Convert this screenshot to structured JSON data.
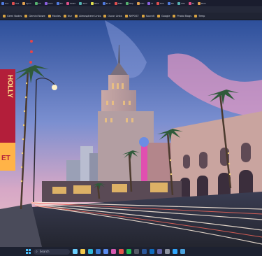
{
  "window": {
    "tabs": [
      {
        "label": "Fon",
        "color": "#4f7be0"
      },
      {
        "label": "Pat",
        "color": "#e04f4f"
      },
      {
        "label": "Spon",
        "color": "#e0a14f"
      },
      {
        "label": "Xa",
        "color": "#55b36f"
      },
      {
        "label": "Gem",
        "color": "#8a5fe0"
      },
      {
        "label": "Pix",
        "color": "#4f7be0"
      },
      {
        "label": "Saam",
        "color": "#e04f8a"
      },
      {
        "label": "Sam",
        "color": "#55b3b3"
      },
      {
        "label": "Nike",
        "color": "#e0e04f"
      },
      {
        "label": "Bl ar",
        "color": "#4f7be0"
      },
      {
        "label": "Nike",
        "color": "#e04f4f"
      },
      {
        "label": "Rep",
        "color": "#55b36f"
      },
      {
        "label": "Pbo",
        "color": "#e0a14f"
      },
      {
        "label": "Pi",
        "color": "#8a5fe0"
      },
      {
        "label": "Pick",
        "color": "#e04f4f"
      },
      {
        "label": "Re",
        "color": "#4f7be0"
      },
      {
        "label": "Inte",
        "color": "#55b3b3"
      },
      {
        "label": "Fa",
        "color": "#e04f8a"
      },
      {
        "label": "Rem",
        "color": "#e0a14f"
      }
    ]
  },
  "bookmarks": {
    "items": [
      {
        "label": "Gemi Nodes"
      },
      {
        "label": "Gemini Nowe"
      },
      {
        "label": "Movies"
      },
      {
        "label": "Nur"
      },
      {
        "label": "Atmosphere Links"
      },
      {
        "label": "Oscar Links"
      },
      {
        "label": "NYPOST"
      },
      {
        "label": "Soundt"
      },
      {
        "label": "Google"
      },
      {
        "label": "Photo Blogs"
      },
      {
        "label": "Temp"
      }
    ]
  },
  "content": {
    "signs": {
      "theater_top": "HOLLY",
      "theater_bottom": "ET"
    }
  },
  "taskbar": {
    "search_placeholder": "Search",
    "apps": [
      {
        "icon": "copilot-icon",
        "color": "#6bd0ff"
      },
      {
        "icon": "file-explorer-icon",
        "color": "#f2c94c"
      },
      {
        "icon": "edge-icon",
        "color": "#2fb8d8"
      },
      {
        "icon": "mail-icon",
        "color": "#3a7bd5"
      },
      {
        "icon": "store-icon",
        "color": "#5b8def"
      },
      {
        "icon": "photos-icon",
        "color": "#d65ab0"
      },
      {
        "icon": "chrome-icon",
        "color": "#e5534b"
      },
      {
        "icon": "spotify-icon",
        "color": "#1db954"
      },
      {
        "icon": "terminal-icon",
        "color": "#555a66"
      },
      {
        "icon": "word-icon",
        "color": "#2b579a"
      },
      {
        "icon": "outlook-icon",
        "color": "#0f6cbd"
      },
      {
        "icon": "teams-icon",
        "color": "#6264a7"
      },
      {
        "icon": "settings-icon",
        "color": "#8d93a1"
      },
      {
        "icon": "photoshop-icon",
        "color": "#31a8ff"
      },
      {
        "icon": "lightroom-icon",
        "color": "#4aa3df"
      }
    ]
  }
}
